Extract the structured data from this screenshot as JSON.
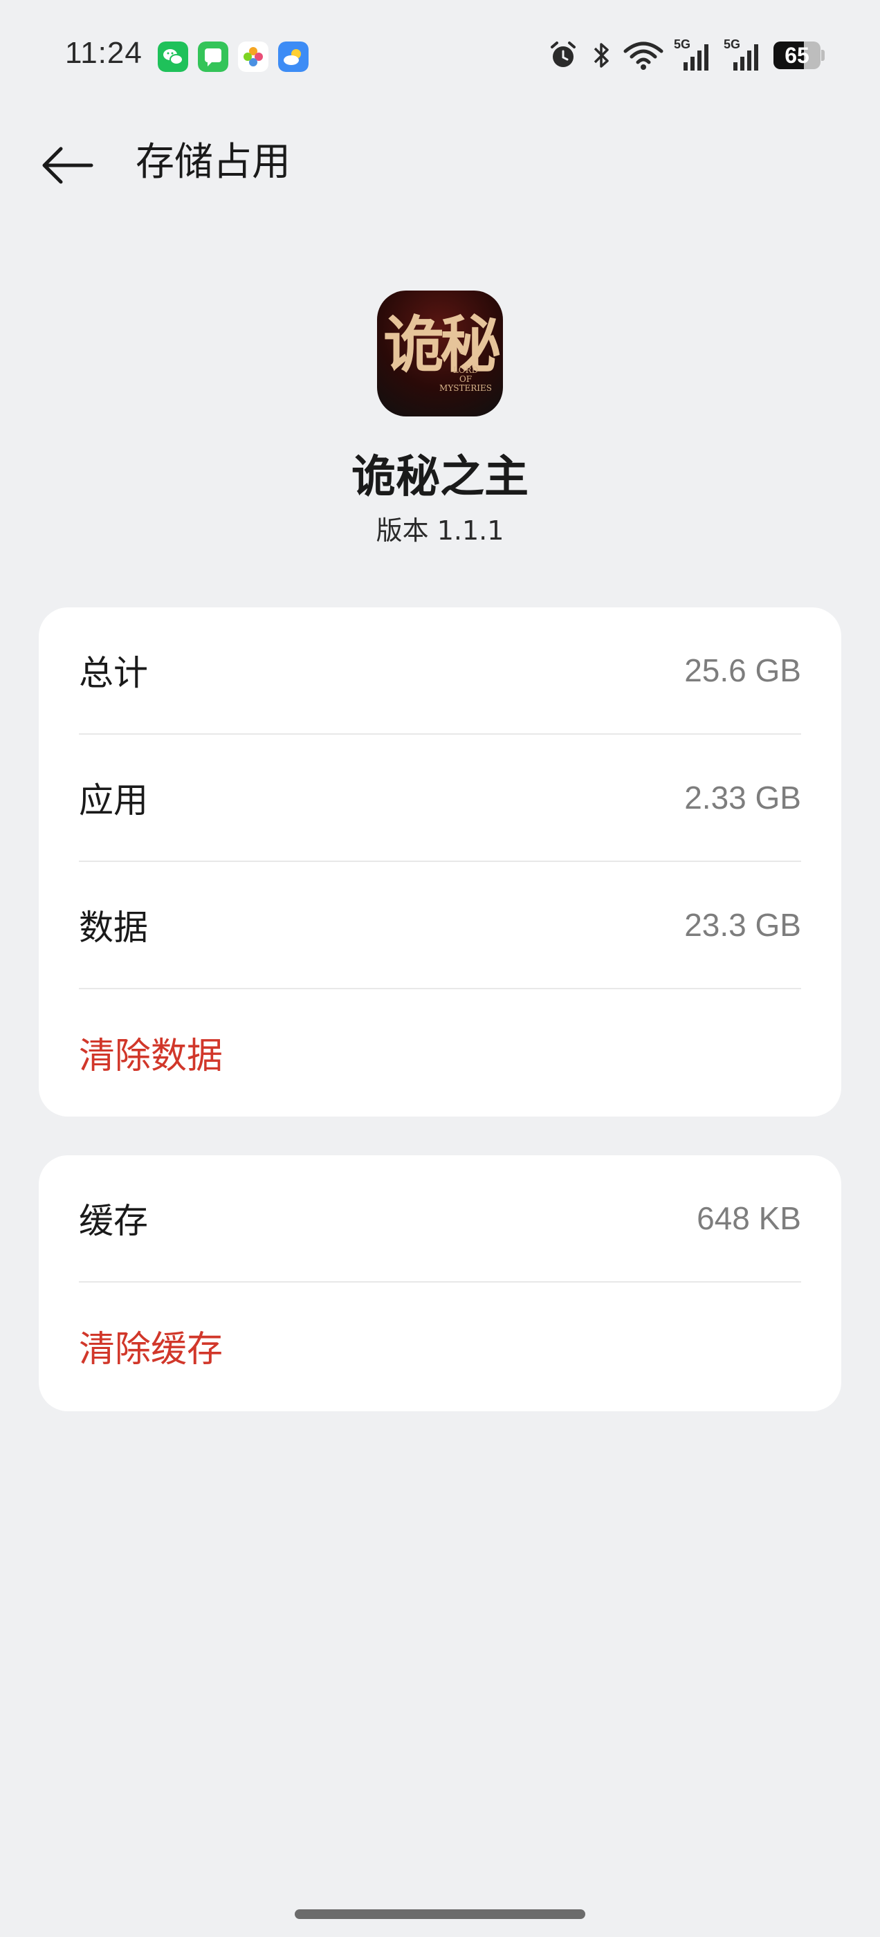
{
  "status_bar": {
    "time": "11:24",
    "notifications": [
      {
        "name": "wechat-icon",
        "color": "#1fc15a"
      },
      {
        "name": "messages-icon",
        "color": "#34c459"
      },
      {
        "name": "photos-icon",
        "color": "#ffffff"
      },
      {
        "name": "weather-icon",
        "color": "#3d8cf5"
      }
    ],
    "signal_1_label": "5G",
    "signal_2_label": "5G",
    "battery_level": "65",
    "battery_percent": 0.65
  },
  "header": {
    "title": "存储占用"
  },
  "app": {
    "icon_glyph": "诡秘",
    "icon_subtitle_1": "LORD",
    "icon_subtitle_2": "OF",
    "icon_subtitle_3": "MYSTERIES",
    "name": "诡秘之主",
    "version": "版本  1.1.1"
  },
  "storage": {
    "total_label": "总计",
    "total_value": "25.6 GB",
    "app_label": "应用",
    "app_value": "2.33 GB",
    "data_label": "数据",
    "data_value": "23.3 GB",
    "clear_data_label": "清除数据"
  },
  "cache": {
    "cache_label": "缓存",
    "cache_value": "648 KB",
    "clear_cache_label": "清除缓存"
  },
  "colors": {
    "background": "#eff0f2",
    "card": "#ffffff",
    "danger": "#d1372a",
    "value_gray": "#7d7d7d"
  }
}
